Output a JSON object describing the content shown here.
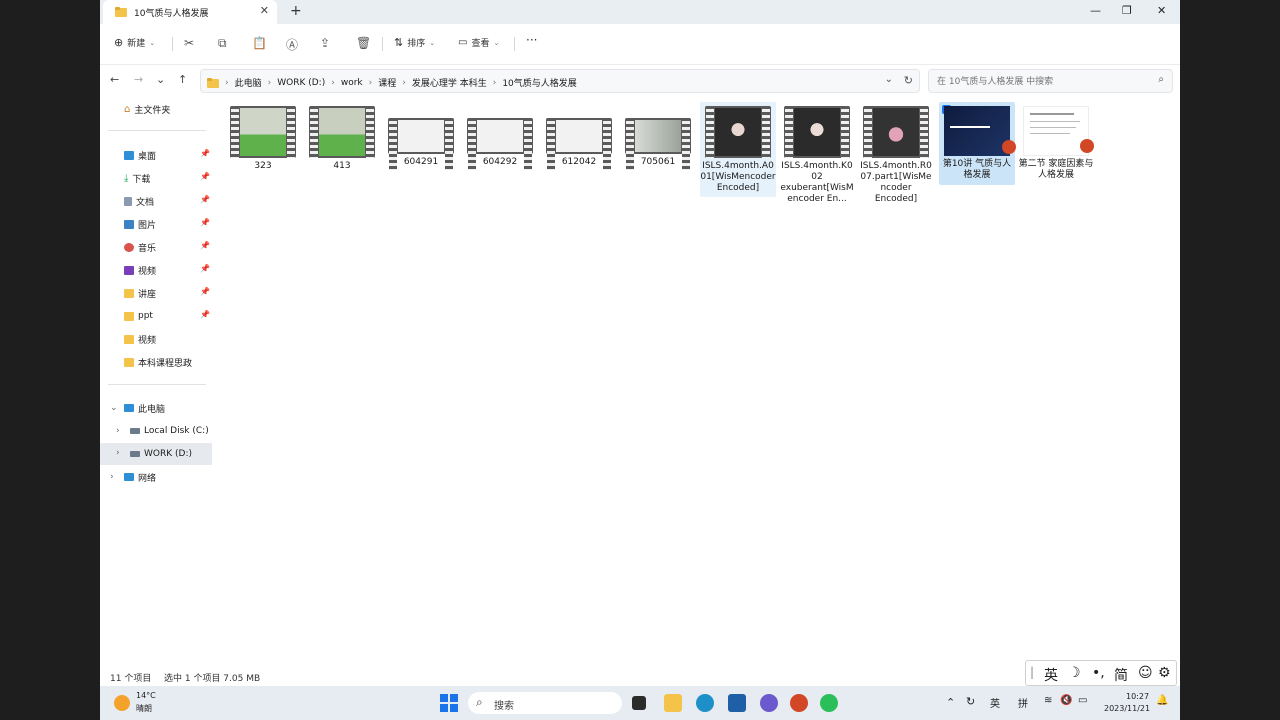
{
  "window": {
    "tab_title": "10气质与人格发展",
    "new_tab": "+",
    "minimize": "—",
    "maximize": "❐",
    "close": "✕"
  },
  "toolbar": {
    "new_label": "新建",
    "sort_label": "排序",
    "view_label": "查看",
    "more_label": "···"
  },
  "address": {
    "crumbs": [
      "此电脑",
      "WORK (D:)",
      "work",
      "课程",
      "发展心理学 本科生",
      "10气质与人格发展"
    ],
    "search_placeholder": "在 10气质与人格发展 中搜索"
  },
  "sidebar": {
    "home": "主文件夹",
    "quick": [
      "桌面",
      "下载",
      "文档",
      "图片",
      "音乐",
      "视频",
      "讲座",
      "ppt",
      "视频",
      "本科课程思政"
    ],
    "this_pc": "此电脑",
    "drives": [
      "Local Disk (C:)",
      "WORK (D:)"
    ],
    "network": "网络"
  },
  "files": [
    {
      "name": "323",
      "kind": "video"
    },
    {
      "name": "413",
      "kind": "video"
    },
    {
      "name": "604291",
      "kind": "video"
    },
    {
      "name": "604292",
      "kind": "video"
    },
    {
      "name": "612042",
      "kind": "video"
    },
    {
      "name": "705061",
      "kind": "video"
    },
    {
      "name": "ISLS.4month.A001[WisMencoder Encoded]",
      "kind": "video"
    },
    {
      "name": "ISLS.4month.K002 exuberant[WisMencoder En...",
      "kind": "video"
    },
    {
      "name": "ISLS.4month.R007.part1[WisMencoder Encoded]",
      "kind": "video"
    },
    {
      "name": "第10讲 气质与人格发展",
      "kind": "ppt"
    },
    {
      "name": "第二节 家庭因素与人格发展",
      "kind": "ppt"
    }
  ],
  "status": {
    "count": "11 个项目",
    "selected": "选中 1 个项目  7.05 MB"
  },
  "taskbar": {
    "weather_temp": "14°C",
    "weather_desc": "晴朗",
    "search": "搜索",
    "ime_lang": "英",
    "ime_mode": "拼",
    "time": "10:27",
    "date": "2023/11/21"
  },
  "ime_bar": {
    "lang": "英",
    "simp": "简"
  },
  "colors": {
    "accent": "#1a73e8",
    "selection": "#cce4f7",
    "ppt": "#d24726"
  }
}
